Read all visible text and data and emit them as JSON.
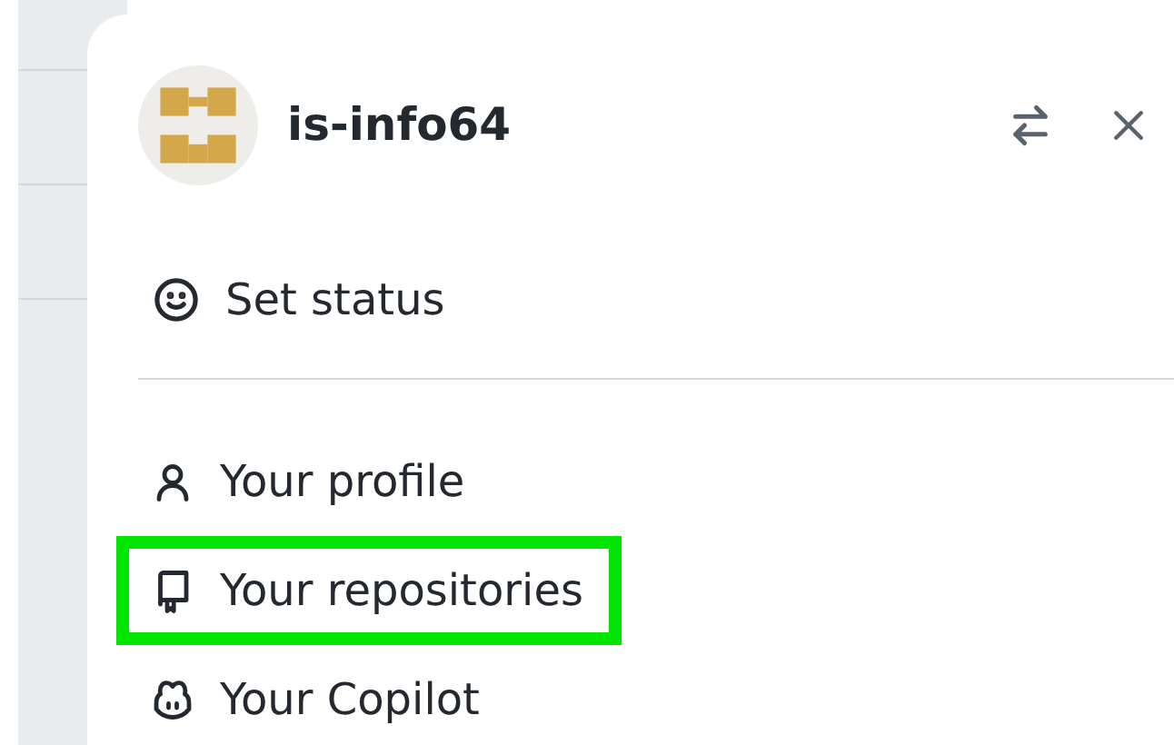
{
  "user_menu": {
    "username": "is-info64",
    "header_actions": [
      {
        "kind": "switch"
      },
      {
        "kind": "close"
      }
    ],
    "status_item": {
      "label": "Set status"
    },
    "items": [
      {
        "label": "Your profile",
        "highlighted": false
      },
      {
        "label": "Your repositories",
        "highlighted": true
      },
      {
        "label": "Your Copilot",
        "highlighted": false
      }
    ]
  }
}
